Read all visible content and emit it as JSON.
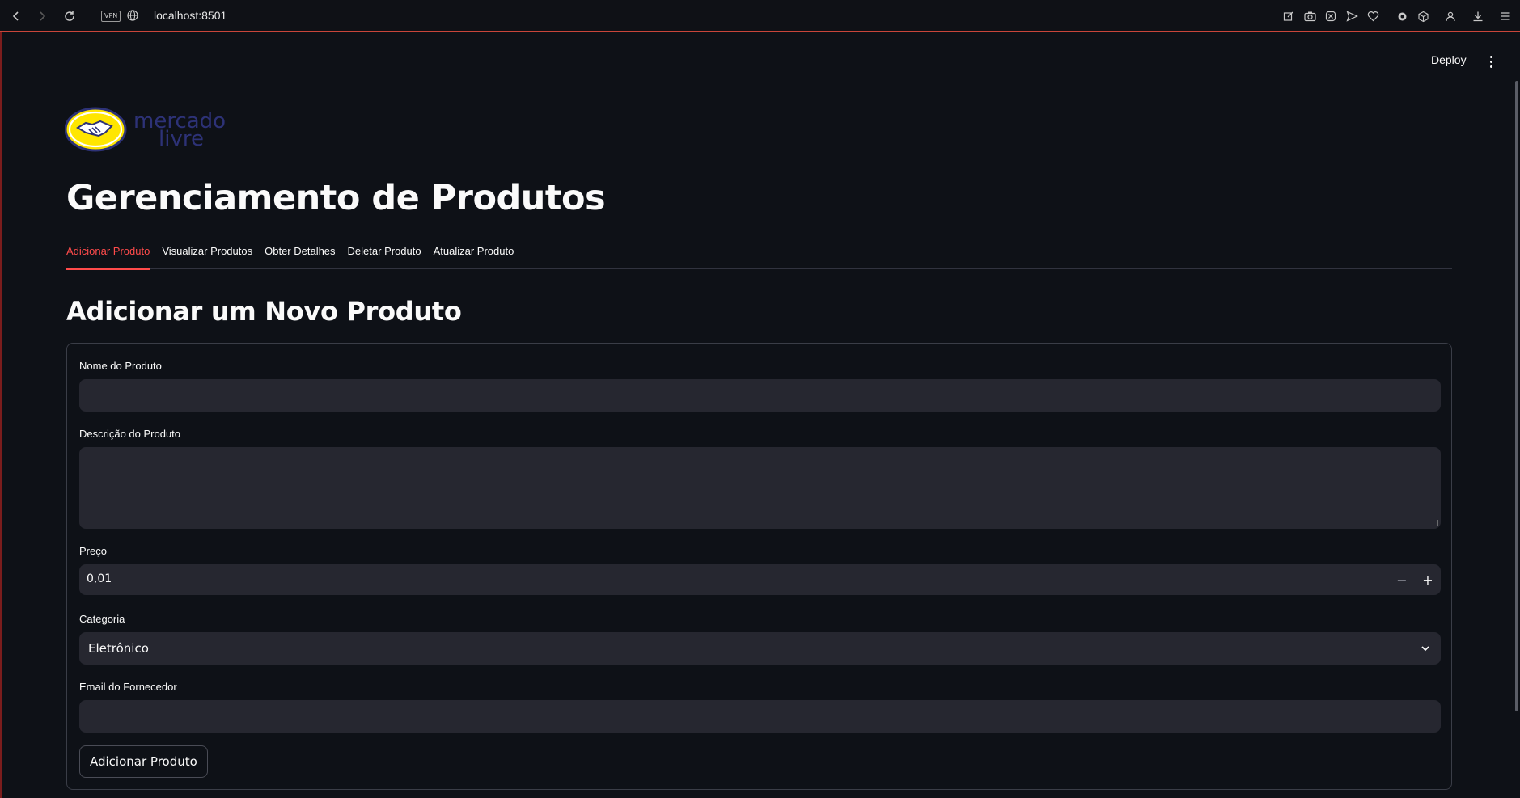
{
  "browser": {
    "url": "localhost:8501",
    "vpn_label": "VPN",
    "toolbar_icons": [
      "edit-icon",
      "camera-icon",
      "close-circle-icon",
      "send-icon",
      "heart-icon",
      "extension-icon",
      "cube-icon",
      "profile-icon",
      "download-icon",
      "menu-icon"
    ]
  },
  "header": {
    "deploy_label": "Deploy"
  },
  "logo": {
    "line1": "mercado",
    "line2": "livre",
    "brand_yellow": "#ffe600",
    "brand_blue": "#2d3277"
  },
  "page": {
    "title": "Gerenciamento de Produtos"
  },
  "tabs": [
    {
      "label": "Adicionar Produto",
      "active": true
    },
    {
      "label": "Visualizar Produtos",
      "active": false
    },
    {
      "label": "Obter Detalhes",
      "active": false
    },
    {
      "label": "Deletar Produto",
      "active": false
    },
    {
      "label": "Atualizar Produto",
      "active": false
    }
  ],
  "form": {
    "subheader": "Adicionar um Novo Produto",
    "name": {
      "label": "Nome do Produto",
      "value": ""
    },
    "description": {
      "label": "Descrição do Produto",
      "value": ""
    },
    "price": {
      "label": "Preço",
      "value": "0,01",
      "minus": "−",
      "plus": "+"
    },
    "category": {
      "label": "Categoria",
      "value": "Eletrônico"
    },
    "email": {
      "label": "Email do Fornecedor",
      "value": ""
    },
    "submit_label": "Adicionar Produto"
  },
  "colors": {
    "background": "#0e1117",
    "input_bg": "#262730",
    "accent": "#ff4b4b"
  }
}
